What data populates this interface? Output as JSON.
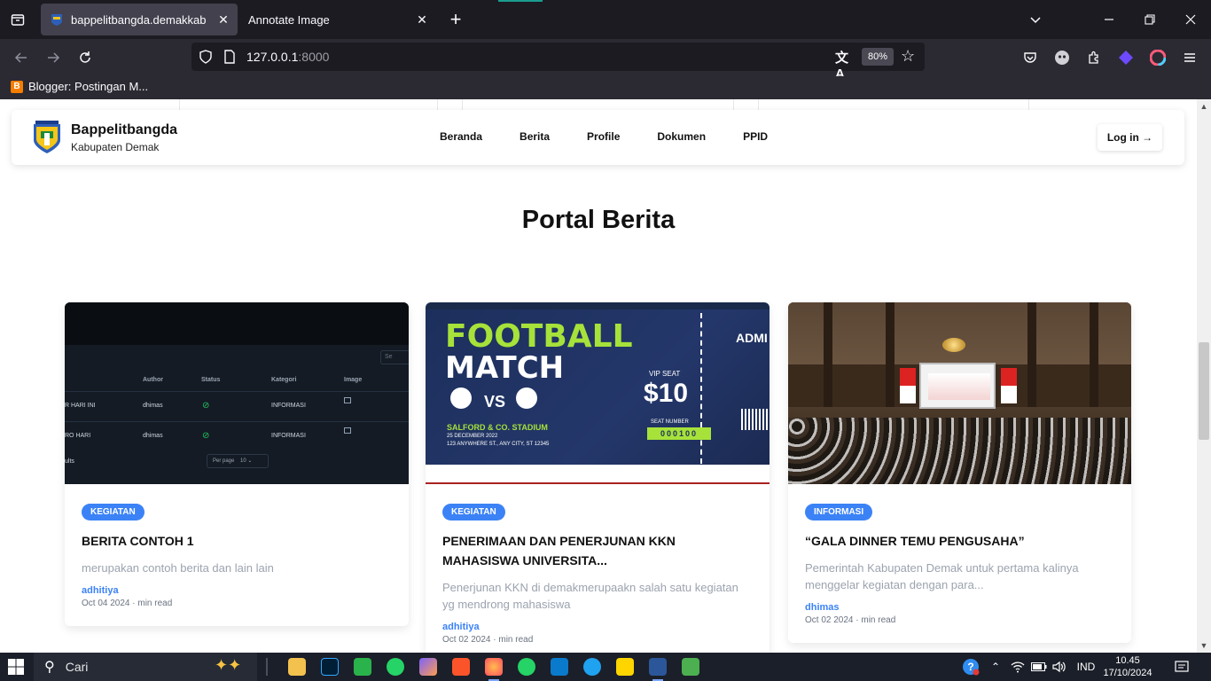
{
  "browser": {
    "tabs": [
      {
        "title": "bappelitbangda.demakkab",
        "active": true
      },
      {
        "title": "Annotate Image",
        "active": false
      }
    ],
    "url_host": "127.0.0.1",
    "url_port": ":8000",
    "zoom": "80%",
    "bookmark": "Blogger: Postingan M..."
  },
  "site": {
    "brand_name": "Bappelitbangda",
    "brand_sub": "Kabupaten Demak",
    "menu": [
      "Beranda",
      "Berita",
      "Profile",
      "Dokumen",
      "PPID"
    ],
    "login": "Log in →",
    "portal_title": "Portal Berita"
  },
  "cards": [
    {
      "badge": "KEGIATAN",
      "title": "BERITA CONTOH 1",
      "excerpt": "merupakan contoh berita dan lain lain",
      "author": "adhitiya",
      "meta": "Oct 04 2024 · min read"
    },
    {
      "badge": "KEGIATAN",
      "title": "PENERIMAAN DAN PENERJUNAN KKN MAHASISWA UNIVERSITA...",
      "excerpt": "Penerjunan KKN di demakmerupaakn salah satu kegiatan yg mendrong mahasiswa",
      "author": "adhitiya",
      "meta": "Oct 02 2024 · min read"
    },
    {
      "badge": "INFORMASI",
      "title": "“GALA DINNER TEMU PENGUSAHA”",
      "excerpt": "Pemerintah Kabupaten Demak untuk pertama kalinya menggelar kegiatan dengan para...",
      "author": "dhimas",
      "meta": "Oct 02 2024 · min read"
    }
  ],
  "img1": {
    "search_label": "Se",
    "headers": [
      "Author",
      "Status",
      "Kategori",
      "Image"
    ],
    "rows": [
      {
        "title": "R HARI INI",
        "author": "dhimas",
        "kategori": "INFORMASI"
      },
      {
        "title": "RO HARI",
        "author": "dhimas",
        "kategori": "INFORMASI"
      }
    ],
    "footer_label": "ults",
    "perpage_label": "Per page",
    "perpage_value": "10"
  },
  "img2": {
    "line1": "FOOTBALL",
    "line2": "MATCH",
    "vs": "VS",
    "venue": "SALFORD & CO. STADIUM",
    "date": "25 DECEMBER 2022",
    "address": "123 ANYWHERE ST., ANY CITY, ST 12345",
    "vip": "VIP SEAT",
    "price": "$10",
    "seat_label": "SEAT NUMBER",
    "seat_number": "000100",
    "admit": "ADMI"
  },
  "taskbar": {
    "search": "Cari",
    "lang": "IND",
    "time": "10.45",
    "date": "17/10/2024"
  }
}
